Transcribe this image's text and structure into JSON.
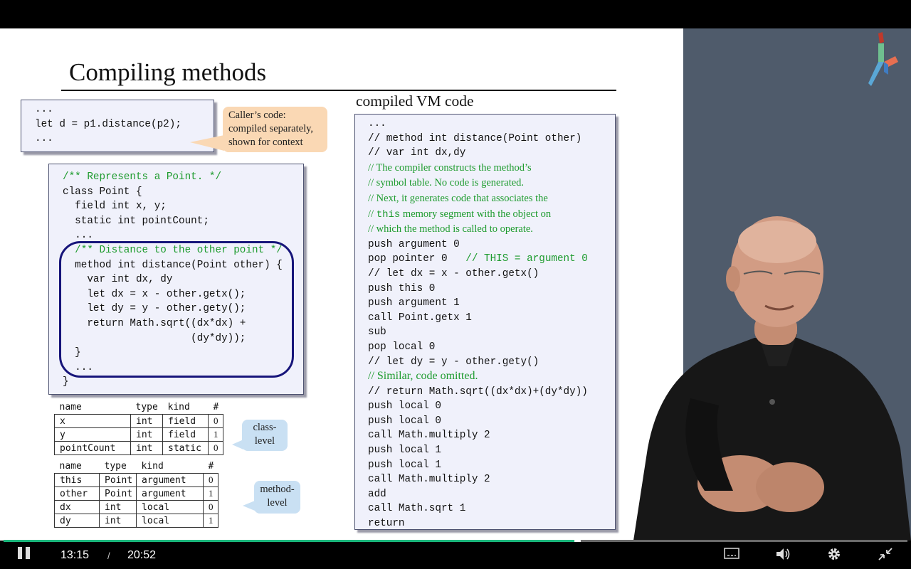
{
  "slide": {
    "title": "Compiling methods",
    "caller_code": "...\nlet d = p1.distance(p2);\n...",
    "caller_callout": "Caller’s code:\ncompiled separately,\nshown for context",
    "point_class_code_1": "/** Represents a Point. */",
    "point_class_code_2": "class Point {\n  field int x, y;\n  static int pointCount;\n  ...",
    "point_class_comment_2": "  /** Distance to the other point */",
    "point_class_code_3": "  method int distance(Point other) {\n    var int dx, dy\n    let dx = x - other.getx();\n    let dy = y - other.gety();\n    return Math.sqrt((dx*dx) +\n                     (dy*dy));\n  }\n  ...\n}",
    "class_table": {
      "headers": [
        "name",
        "type",
        "kind",
        "#"
      ],
      "rows": [
        [
          "x",
          "int",
          "field",
          "0"
        ],
        [
          "y",
          "int",
          "field",
          "1"
        ],
        [
          "pointCount",
          "int",
          "static",
          "0"
        ]
      ]
    },
    "class_callout": "class-\nlevel",
    "method_table": {
      "headers": [
        "name",
        "type",
        "kind",
        "#"
      ],
      "rows": [
        [
          "this",
          "Point",
          "argument",
          "0"
        ],
        [
          "other",
          "Point",
          "argument",
          "1"
        ],
        [
          "dx",
          "int",
          "local",
          "0"
        ],
        [
          "dy",
          "int",
          "local",
          "1"
        ]
      ]
    },
    "method_callout": "method-\nlevel",
    "vm_title": "compiled VM code",
    "vm_code_1": "...\n// method int distance(Point other)\n// var int dx,dy",
    "vm_comment_a": "// The compiler constructs the method’s\n// symbol table. No code is generated.\n// Next, it generates code that associates the",
    "vm_comment_b_pre": "// ",
    "vm_comment_b_this": "this",
    "vm_comment_b_post": " memory segment with the object on",
    "vm_comment_c": "// which the method is called to operate.",
    "vm_code_2": "push argument 0",
    "vm_code_3": "pop pointer 0   ",
    "vm_code_3_comment": "// THIS = argument 0",
    "vm_code_4": "// let dx = x - other.getx()\npush this 0\npush argument 1\ncall Point.getx 1\nsub\npop local 0\n// let dy = y - other.gety()",
    "vm_comment_d": "// Similar, code omitted.",
    "vm_code_5": "// return Math.sqrt((dx*dx)+(dy*dy))\npush local 0\npush local 0\ncall Math.multiply 2\npush local 1\npush local 1\ncall Math.multiply 2\nadd\ncall Math.sqrt 1\nreturn"
  },
  "player": {
    "current_time": "13:15",
    "separator": "/",
    "duration": "20:52",
    "progress": 0.635
  },
  "icons": {
    "play_pause": "pause-icon",
    "captions": "captions-icon",
    "volume": "volume-icon",
    "settings": "gear-icon",
    "fullscreen": "exit-fullscreen-icon",
    "logo": "nand2tetris-logo-icon"
  },
  "colors": {
    "comment_green": "#1d9b2e",
    "oval_blue": "#17157a",
    "progress_green": "#1bb77c",
    "side_panel": "#4f5b6b"
  }
}
